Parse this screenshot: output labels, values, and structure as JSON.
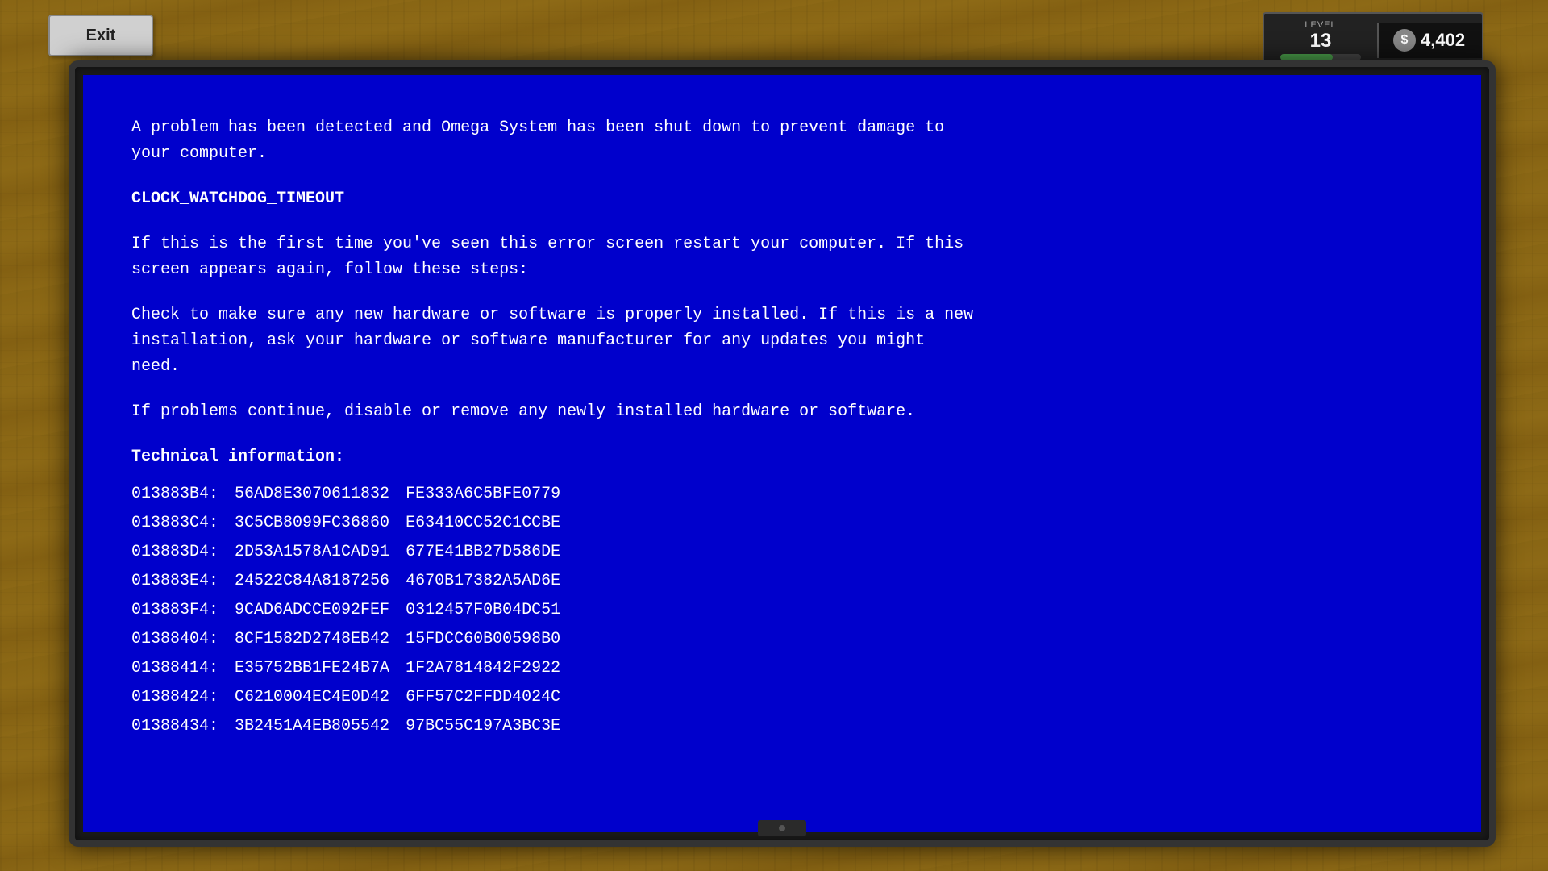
{
  "exit_button": {
    "label": "Exit"
  },
  "hud": {
    "level_label": "LEVEL",
    "level_number": "13",
    "money_icon": "$",
    "money_amount": "4,402",
    "progress_percent": 65
  },
  "bsod": {
    "intro_line1": "A problem has been detected and Omega System has been shut down to prevent damage to",
    "intro_line2": "your computer.",
    "error_code": "CLOCK_WATCHDOG_TIMEOUT",
    "paragraph1_line1": "If this is the first time you've seen this error screen restart your computer. If this",
    "paragraph1_line2": "screen appears again, follow these steps:",
    "paragraph2_line1": "Check to make sure any new hardware or software is properly installed. If this is a new",
    "paragraph2_line2": "installation, ask your hardware or software manufacturer for any updates you might",
    "paragraph2_line3": "need.",
    "paragraph3": "If problems continue, disable or remove any newly installed hardware or software.",
    "tech_title": "Technical information:",
    "tech_rows": [
      {
        "addr": "013883B4:",
        "val1": "56AD8E3070611832",
        "val2": "FE333A6C5BFE0779"
      },
      {
        "addr": "013883C4:",
        "val1": "3C5CB8099FC36860",
        "val2": "E63410CC52C1CCBE"
      },
      {
        "addr": "013883D4:",
        "val1": "2D53A1578A1CAD91",
        "val2": "677E41BB27D586DE"
      },
      {
        "addr": "013883E4:",
        "val1": "24522C84A8187256",
        "val2": "4670B17382A5AD6E"
      },
      {
        "addr": "013883F4:",
        "val1": "9CAD6ADCCE092FEF",
        "val2": "0312457F0B04DC51"
      },
      {
        "addr": "01388404:",
        "val1": "8CF1582D2748EB42",
        "val2": "15FDCC60B00598B0"
      },
      {
        "addr": "01388414:",
        "val1": "E35752BB1FE24B7A",
        "val2": "1F2A7814842F2922"
      },
      {
        "addr": "01388424:",
        "val1": "C6210004EC4E0D42",
        "val2": "6FF57C2FFDD4024C"
      },
      {
        "addr": "01388434:",
        "val1": "3B2451A4EB805542",
        "val2": "97BC55C197A3BC3E"
      }
    ]
  }
}
